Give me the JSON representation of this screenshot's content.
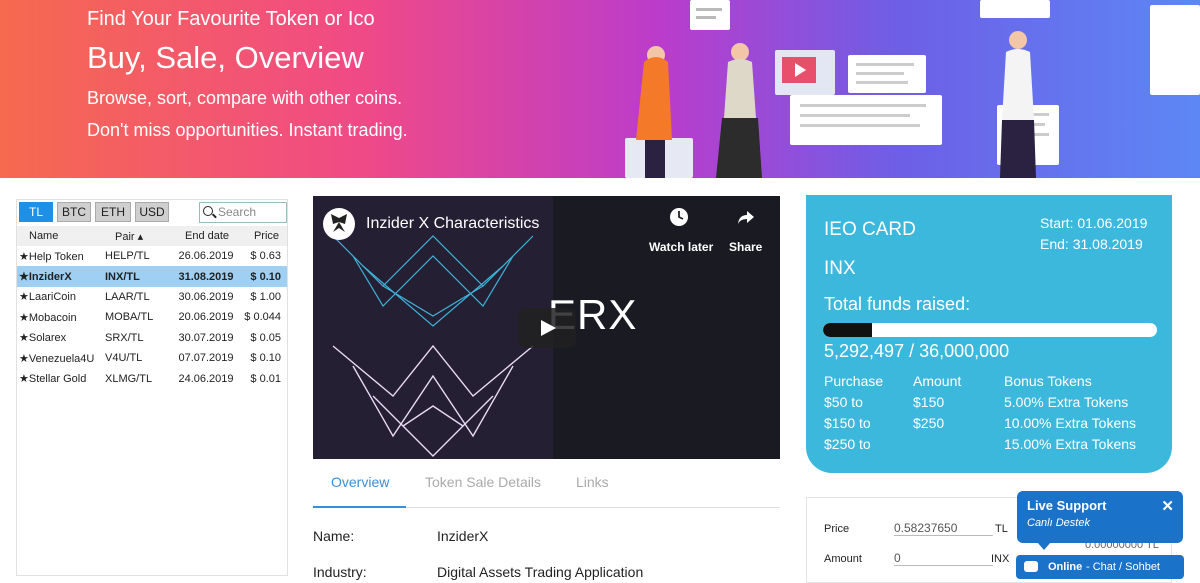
{
  "banner": {
    "line1": "Find Your Favourite Token or Ico",
    "line2": "Buy, Sale, Overview",
    "line3": "Browse, sort, compare with other coins.",
    "line4": "Don't miss opportunities. Instant trading."
  },
  "filters": {
    "tabs": [
      "TL",
      "BTC",
      "ETH",
      "USD"
    ],
    "active": "TL",
    "search_placeholder": "Search"
  },
  "coins_table": {
    "headers": [
      "Name",
      "Pair ▴",
      "End date",
      "Price"
    ],
    "rows": [
      {
        "name": "Help Token",
        "pair": "HELP/TL",
        "end": "26.06.2019",
        "price": "$ 0.63"
      },
      {
        "name": "InziderX",
        "pair": "INX/TL",
        "end": "31.08.2019",
        "price": "$ 0.10"
      },
      {
        "name": "LaariCoin",
        "pair": "LAAR/TL",
        "end": "30.06.2019",
        "price": "$ 1.00"
      },
      {
        "name": "Mobacoin",
        "pair": "MOBA/TL",
        "end": "20.06.2019",
        "price": "$ 0.044"
      },
      {
        "name": "Solarex",
        "pair": "SRX/TL",
        "end": "30.07.2019",
        "price": "$ 0.05"
      },
      {
        "name": "Venezuela4U",
        "pair": "V4U/TL",
        "end": "07.07.2019",
        "price": "$ 0.10"
      },
      {
        "name": "Stellar Gold",
        "pair": "XLMG/TL",
        "end": "24.06.2019",
        "price": "$ 0.01"
      }
    ],
    "selected_index": 1
  },
  "video": {
    "title": "Inzider X Characteristics",
    "watch_later": "Watch later",
    "share": "Share",
    "overlay_text": "ERX"
  },
  "detail_tabs": {
    "overview": "Overview",
    "token_sale": "Token Sale Details",
    "links": "Links"
  },
  "details": {
    "name_label": "Name:",
    "name_value": "InziderX",
    "industry_label": "Industry:",
    "industry_value": "Digital Assets Trading Application"
  },
  "ieo": {
    "title": "IEO CARD",
    "symbol": "INX",
    "start": "Start: 01.06.2019",
    "end": "End: 31.08.2019",
    "funds_label": "Total funds raised:",
    "funds_text": "5,292,497 / 36,000,000",
    "progress_fraction": 0.147,
    "headers": [
      "Purchase",
      "Amount",
      "Bonus Tokens"
    ],
    "rows": [
      [
        "$50 to",
        "$150",
        "5.00% Extra Tokens"
      ],
      [
        "$150 to",
        "$250",
        "10.00% Extra Tokens"
      ],
      [
        "$250 to",
        "",
        "15.00% Extra Tokens"
      ]
    ]
  },
  "trade": {
    "price_label": "Price",
    "price_value": "0.58237650",
    "price_currency": "TL",
    "amount_label": "Amount",
    "amount_value": "0",
    "amount_currency": "INX",
    "hidden_value": "0.00000000 TL"
  },
  "live_support": {
    "title": "Live Support",
    "subtitle": "Canlı Destek",
    "close": "✕",
    "bar_status": "Online",
    "bar_text": " - Chat / Sohbet"
  },
  "colors": {
    "accent_blue": "#1e90e6",
    "ieo_bg": "#3db8dd",
    "live_support": "#1a73c8"
  }
}
